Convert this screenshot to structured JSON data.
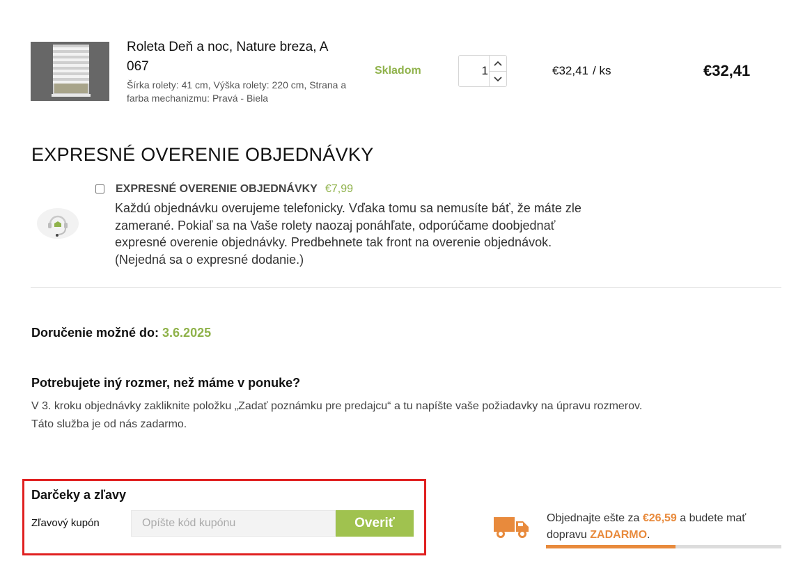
{
  "product": {
    "name": "Roleta Deň a noc, Nature breza, A 067",
    "description": "Šírka rolety: 41 cm, Výška rolety: 220 cm, Strana a farba mechanizmu: Pravá - Biela",
    "stock": "Skladom",
    "quantity": "1",
    "unit_price": "€32,41",
    "unit_suffix": "/ ks",
    "total": "€32,41"
  },
  "express": {
    "section_title": "EXPRESNÉ OVERENIE OBJEDNÁVKY",
    "option_label": "EXPRESNÉ OVERENIE OBJEDNÁVKY",
    "option_price": "€7,99",
    "checked": false,
    "description": "Každú objednávku overujeme telefonicky. Vďaka tomu sa nemusíte báť, že máte zle zamerané. Pokiaľ sa na Vaše rolety naozaj ponáhľate, odporúčame doobjednať expresné overenie objednávky. Predbehnete tak front na overenie objednávok. (Nejedná sa o expresné dodanie.)"
  },
  "delivery": {
    "label": "Doručenie možné do:",
    "date": "3.6.2025"
  },
  "custom_size": {
    "title": "Potrebujete iný rozmer, než máme v ponuke?",
    "line1": "V 3. kroku objednávky zakliknite položku „Zadať poznámku pre predajcu“ a tu napíšte vaše požiadavky na úpravu rozmerov.",
    "line2": "Táto služba je od nás zadarmo."
  },
  "coupon": {
    "title": "Darčeky a zľavy",
    "label": "Zľavový kupón",
    "placeholder": "Opíšte kód kupónu",
    "button": "Overiť"
  },
  "shipping": {
    "text_before": "Objednajte ešte za",
    "amount": "€26,59",
    "text_middle": "a budete mať dopravu",
    "free": "ZADARMO",
    "text_after": ".",
    "progress_percent": 55
  },
  "colors": {
    "accent_green": "#8fb24a",
    "button_green": "#a0c24f",
    "orange": "#e88a3c",
    "highlight_red": "#e02020"
  },
  "icons": {
    "quantity_up": "chevron-up-icon",
    "quantity_down": "chevron-down-icon",
    "express": "headset-icon",
    "shipping": "truck-icon"
  }
}
